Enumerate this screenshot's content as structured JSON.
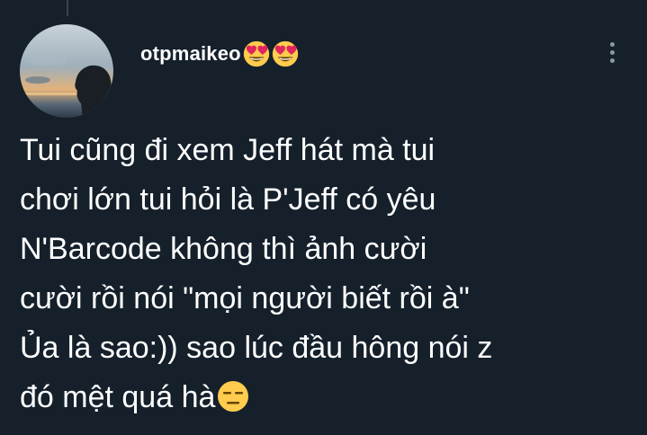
{
  "tweet": {
    "username": "otpmaikeo",
    "username_emojis": [
      "heart-eyes-emoji",
      "heart-eyes-emoji"
    ],
    "lines": [
      "Tui cũng đi xem Jeff hát mà tui",
      "chơi lớn tui hỏi là P'Jeff có yêu",
      "N'Barcode không thì ảnh cười",
      "cười rồi nói \"mọi người biết rồi à\"",
      "Ủa là sao:)) sao lúc đầu hông nói z",
      "đó mệt quá hà"
    ],
    "trailing_emoji": "expressionless-face-emoji",
    "more_icon": "more-vertical-icon"
  },
  "colors": {
    "background": "#15202b",
    "text": "#ffffff",
    "secondary": "#8b98a5"
  }
}
